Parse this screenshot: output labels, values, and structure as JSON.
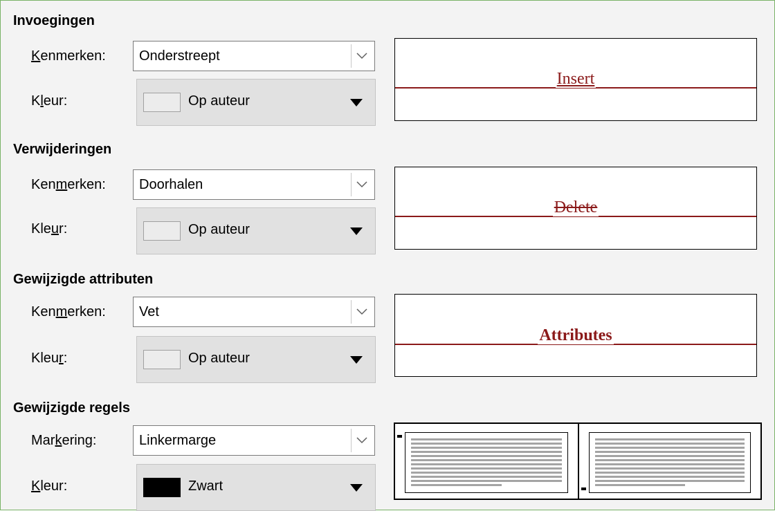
{
  "sections": [
    {
      "title": "Invoegingen",
      "attr_label_pre": "",
      "attr_label_ul": "K",
      "attr_label_post": "enmerken:",
      "attr_value": "Onderstreept",
      "color_label_pre": "K",
      "color_label_ul": "l",
      "color_label_post": "eur:",
      "color_value": "Op auteur",
      "preview_text": "Insert"
    },
    {
      "title": "Verwijderingen",
      "attr_label_pre": "Ken",
      "attr_label_ul": "m",
      "attr_label_post": "erken:",
      "attr_value": "Doorhalen",
      "color_label_pre": "Kle",
      "color_label_ul": "u",
      "color_label_post": "r:",
      "color_value": "Op auteur",
      "preview_text": "Delete"
    },
    {
      "title": "Gewijzigde attributen",
      "attr_label_pre": "Ken",
      "attr_label_ul": "m",
      "attr_label_post": "erken:",
      "attr_value": "Vet",
      "color_label_pre": "Kleu",
      "color_label_ul": "r",
      "color_label_post": ":",
      "color_value": "Op auteur",
      "preview_text": "Attributes"
    },
    {
      "title": "Gewijzigde regels",
      "attr_label_pre": "Mar",
      "attr_label_ul": "k",
      "attr_label_post": "ering:",
      "attr_value": "Linkermarge",
      "color_label_pre": "",
      "color_label_ul": "K",
      "color_label_post": "leur:",
      "color_value": "Zwart"
    }
  ],
  "icons": {
    "dropdown": "chevron-down-icon",
    "color_dropdown": "triangle-down-icon"
  },
  "colors": {
    "preview_red": "#8b1a1a",
    "default_swatch": "#ececec",
    "black_swatch": "#000000"
  }
}
